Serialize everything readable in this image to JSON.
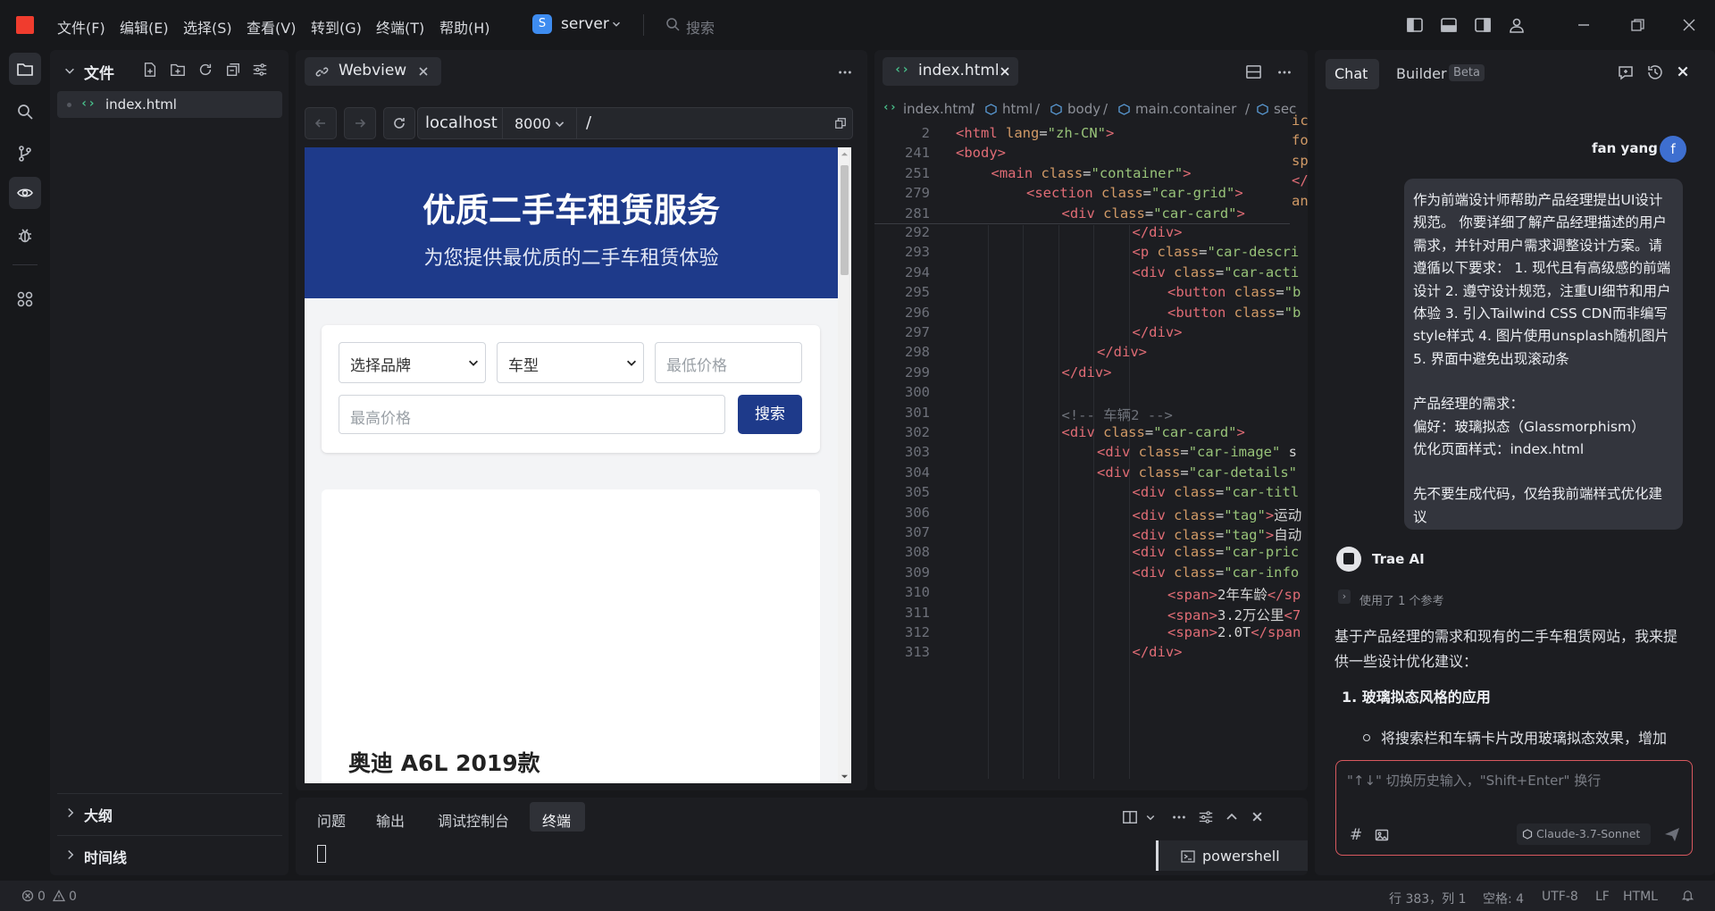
{
  "titlebar": {
    "menu": [
      "文件(F)",
      "编辑(E)",
      "选择(S)",
      "查看(V)",
      "转到(G)",
      "终端(T)",
      "帮助(H)"
    ],
    "server_badge": "S",
    "server_name": "server",
    "search_placeholder": "搜索"
  },
  "activity_bar": [
    "files-icon",
    "search-icon",
    "source-control-icon",
    "webview-icon",
    "debug-icon",
    "extensions-icon"
  ],
  "explorer": {
    "title": "文件",
    "file": "index.html",
    "outline": "大纲",
    "timeline": "时间线"
  },
  "webview": {
    "tab_label": "Webview",
    "host": "localhost",
    "port": "8000",
    "path": "/",
    "page": {
      "hero_title": "优质二手车租赁服务",
      "hero_subtitle": "为您提供最优质的二手车租赁体验",
      "brand_select": "选择品牌",
      "type_select": "车型",
      "min_price_placeholder": "最低价格",
      "max_price_placeholder": "最高价格",
      "search_button": "搜索",
      "car_title": "奥迪 A6L 2019款"
    }
  },
  "editor": {
    "tab_label": "index.html",
    "breadcrumb": [
      "index.html",
      "html",
      "body",
      "main.container",
      "sec"
    ],
    "sticky_lines": [
      {
        "n": "2",
        "indent": 0,
        "parts": [
          [
            "tg",
            "<html "
          ],
          [
            "at",
            "lang"
          ],
          [
            "tx",
            "="
          ],
          [
            "st",
            "\"zh-CN\""
          ],
          [
            "tg",
            ">"
          ]
        ]
      },
      {
        "n": "241",
        "indent": 0,
        "parts": [
          [
            "tg",
            "<body>"
          ]
        ]
      },
      {
        "n": "251",
        "indent": 1,
        "parts": [
          [
            "tg",
            "<main "
          ],
          [
            "at",
            "class"
          ],
          [
            "tx",
            "="
          ],
          [
            "st",
            "\"container\""
          ],
          [
            "tg",
            ">"
          ]
        ]
      },
      {
        "n": "279",
        "indent": 2,
        "parts": [
          [
            "tg",
            "<section "
          ],
          [
            "at",
            "class"
          ],
          [
            "tx",
            "="
          ],
          [
            "st",
            "\"car-grid\""
          ],
          [
            "tg",
            ">"
          ]
        ]
      },
      {
        "n": "281",
        "indent": 3,
        "parts": [
          [
            "tg",
            "<div "
          ],
          [
            "at",
            "class"
          ],
          [
            "tx",
            "="
          ],
          [
            "st",
            "\"car-card\""
          ],
          [
            "tg",
            ">"
          ]
        ]
      }
    ],
    "lines": [
      {
        "n": "292",
        "indent": 5,
        "parts": [
          [
            "tg",
            "</div>"
          ]
        ]
      },
      {
        "n": "293",
        "indent": 5,
        "parts": [
          [
            "tg",
            "<p "
          ],
          [
            "at",
            "class"
          ],
          [
            "tx",
            "="
          ],
          [
            "st",
            "\"car-descri"
          ]
        ]
      },
      {
        "n": "294",
        "indent": 5,
        "parts": [
          [
            "tg",
            "<div "
          ],
          [
            "at",
            "class"
          ],
          [
            "tx",
            "="
          ],
          [
            "st",
            "\"car-acti"
          ]
        ]
      },
      {
        "n": "295",
        "indent": 6,
        "parts": [
          [
            "tg",
            "<button "
          ],
          [
            "at",
            "class"
          ],
          [
            "tx",
            "="
          ],
          [
            "st",
            "\"b"
          ]
        ]
      },
      {
        "n": "296",
        "indent": 6,
        "parts": [
          [
            "tg",
            "<button "
          ],
          [
            "at",
            "class"
          ],
          [
            "tx",
            "="
          ],
          [
            "st",
            "\"b"
          ]
        ]
      },
      {
        "n": "297",
        "indent": 5,
        "parts": [
          [
            "tg",
            "</div>"
          ]
        ]
      },
      {
        "n": "298",
        "indent": 4,
        "parts": [
          [
            "tg",
            "</div>"
          ]
        ]
      },
      {
        "n": "299",
        "indent": 3,
        "parts": [
          [
            "tg",
            "</div>"
          ]
        ]
      },
      {
        "n": "300",
        "indent": 0,
        "parts": []
      },
      {
        "n": "301",
        "indent": 3,
        "parts": [
          [
            "cm",
            "<!-- 车辆2 -->"
          ]
        ]
      },
      {
        "n": "302",
        "indent": 3,
        "parts": [
          [
            "tg",
            "<div "
          ],
          [
            "at",
            "class"
          ],
          [
            "tx",
            "="
          ],
          [
            "st",
            "\"car-card\""
          ],
          [
            "tg",
            ">"
          ]
        ]
      },
      {
        "n": "303",
        "indent": 4,
        "parts": [
          [
            "tg",
            "<div "
          ],
          [
            "at",
            "class"
          ],
          [
            "tx",
            "="
          ],
          [
            "st",
            "\"car-image\""
          ],
          [
            "tx",
            " s"
          ]
        ]
      },
      {
        "n": "304",
        "indent": 4,
        "parts": [
          [
            "tg",
            "<div "
          ],
          [
            "at",
            "class"
          ],
          [
            "tx",
            "="
          ],
          [
            "st",
            "\"car-details\""
          ]
        ]
      },
      {
        "n": "305",
        "indent": 5,
        "parts": [
          [
            "tg",
            "<div "
          ],
          [
            "at",
            "class"
          ],
          [
            "tx",
            "="
          ],
          [
            "st",
            "\"car-titl"
          ]
        ]
      },
      {
        "n": "306",
        "indent": 5,
        "parts": [
          [
            "tg",
            "<div "
          ],
          [
            "at",
            "class"
          ],
          [
            "tx",
            "="
          ],
          [
            "st",
            "\"tag\""
          ],
          [
            "tg",
            ">"
          ],
          [
            "tx",
            "运动"
          ]
        ]
      },
      {
        "n": "307",
        "indent": 5,
        "parts": [
          [
            "tg",
            "<div "
          ],
          [
            "at",
            "class"
          ],
          [
            "tx",
            "="
          ],
          [
            "st",
            "\"tag\""
          ],
          [
            "tg",
            ">"
          ],
          [
            "tx",
            "自动"
          ]
        ]
      },
      {
        "n": "308",
        "indent": 5,
        "parts": [
          [
            "tg",
            "<div "
          ],
          [
            "at",
            "class"
          ],
          [
            "tx",
            "="
          ],
          [
            "st",
            "\"car-pric"
          ]
        ]
      },
      {
        "n": "309",
        "indent": 5,
        "parts": [
          [
            "tg",
            "<div "
          ],
          [
            "at",
            "class"
          ],
          [
            "tx",
            "="
          ],
          [
            "st",
            "\"car-info"
          ]
        ]
      },
      {
        "n": "310",
        "indent": 6,
        "parts": [
          [
            "tg",
            "<span>"
          ],
          [
            "tx",
            "2年车龄"
          ],
          [
            "tg",
            "</sp"
          ]
        ]
      },
      {
        "n": "311",
        "indent": 6,
        "parts": [
          [
            "tg",
            "<span>"
          ],
          [
            "tx",
            "3.2万公里"
          ],
          [
            "tg",
            "<7"
          ]
        ]
      },
      {
        "n": "312",
        "indent": 6,
        "parts": [
          [
            "tg",
            "<span>"
          ],
          [
            "tx",
            "2.0T"
          ],
          [
            "tg",
            "</span"
          ]
        ]
      },
      {
        "n": "313",
        "indent": 5,
        "parts": [
          [
            "tg",
            "</div>"
          ]
        ]
      }
    ],
    "minimap": [
      [
        [
          "at",
          "ic"
        ]
      ],
      [
        [
          "at",
          "fo"
        ]
      ],
      [
        [
          "at",
          "sp"
        ]
      ],
      [
        [
          "tg",
          "</"
        ]
      ],
      [
        [
          "at",
          "an"
        ]
      ]
    ]
  },
  "terminal": {
    "tabs": [
      "问题",
      "输出",
      "调试控制台",
      "终端"
    ],
    "active_tab": "终端",
    "shell": "powershell"
  },
  "chat": {
    "tabs": {
      "chat": "Chat",
      "builder": "Builder",
      "beta": "Beta"
    },
    "user_name": "fan yang",
    "user_initial": "f",
    "user_message": [
      "作为前端设计师帮助产品经理提出UI设计规范。 你要详细了解产品经理描述的用户需求，并针对用户需求调整设计方案。请遵循以下要求： 1. 现代且有高级感的前端设计 2. 遵守设计规范，注重UI细节和用户体验 3. 引入Tailwind CSS CDN而非编写style样式 4. 图片使用unsplash随机图片 5. 界面中避免出现滚动条",
      "产品经理的需求：",
      "偏好：玻璃拟态（Glassmorphism）",
      "优化页面样式：index.html",
      "先不要生成代码，仅给我前端样式优化建议"
    ],
    "ai_name": "Trae AI",
    "reference_note": "使用了 1 个参考",
    "reply_intro": "基于产品经理的需求和现有的二手车租赁网站，我来提供一些设计优化建议：",
    "reply_heading": "1. 玻璃拟态风格的应用",
    "reply_bullet": "将搜索栏和车辆卡片改用玻璃拟态效果，增加",
    "input_placeholder": "\"↑↓\" 切换历史输入，\"Shift+Enter\" 换行",
    "model": "Claude-3.7-Sonnet"
  },
  "statusbar": {
    "errors": "0",
    "warnings": "0",
    "position": "行 383，列 1",
    "spaces": "空格: 4",
    "encoding": "UTF-8",
    "eol": "LF",
    "language": "HTML"
  }
}
